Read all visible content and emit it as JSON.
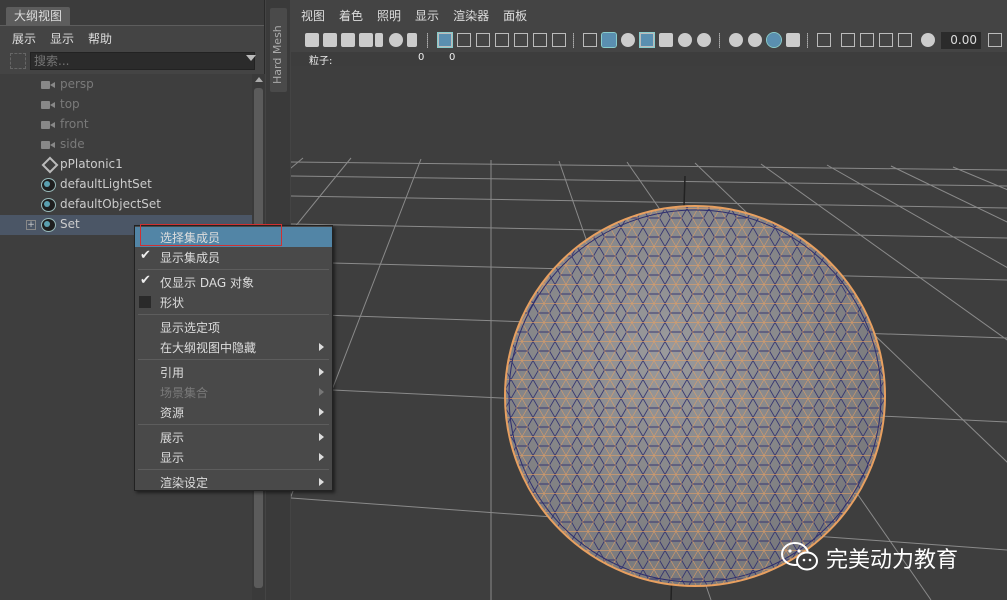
{
  "outliner": {
    "tab_label": "大纲视图",
    "menu": [
      "展示",
      "显示",
      "帮助"
    ],
    "search_placeholder": "搜索...",
    "items": [
      {
        "label": "persp",
        "icon": "camera-icon",
        "dim": true
      },
      {
        "label": "top",
        "icon": "camera-icon",
        "dim": true
      },
      {
        "label": "front",
        "icon": "camera-icon",
        "dim": true
      },
      {
        "label": "side",
        "icon": "camera-icon",
        "dim": true
      },
      {
        "label": "pPlatonic1",
        "icon": "mesh-icon",
        "dim": false
      },
      {
        "label": "defaultLightSet",
        "icon": "set-icon",
        "dim": false
      },
      {
        "label": "defaultObjectSet",
        "icon": "set-icon",
        "dim": false
      },
      {
        "label": "Set",
        "icon": "set-icon",
        "dim": false,
        "expander": "+"
      }
    ]
  },
  "shelf": {
    "label": "Hard Mesh"
  },
  "viewport": {
    "menu": [
      "视图",
      "着色",
      "照明",
      "显示",
      "渲染器",
      "面板"
    ],
    "toolbar_value": "0.00",
    "hud": {
      "label": "粒子:",
      "val1": "0",
      "val2": "0"
    }
  },
  "context_menu": {
    "items": {
      "select_members": "选择集成员",
      "show_members": "显示集成员",
      "dag_only": "仅显示 DAG 对象",
      "shapes": "形状",
      "show_selected": "显示选定项",
      "hide_in_outliner": "在大纲视图中隐藏",
      "reference": "引用",
      "scene_assembly": "场景集合",
      "assets": "资源",
      "display_show": "展示",
      "display": "显示",
      "render_settings": "渲染设定"
    }
  },
  "watermark": {
    "text": "完美动力教育"
  },
  "colors": {
    "wire_orange": "#e8a060",
    "wire_blue": "#2a2a6a",
    "sphere_gray": "#8a8a8c",
    "highlight": "#5285a6"
  }
}
